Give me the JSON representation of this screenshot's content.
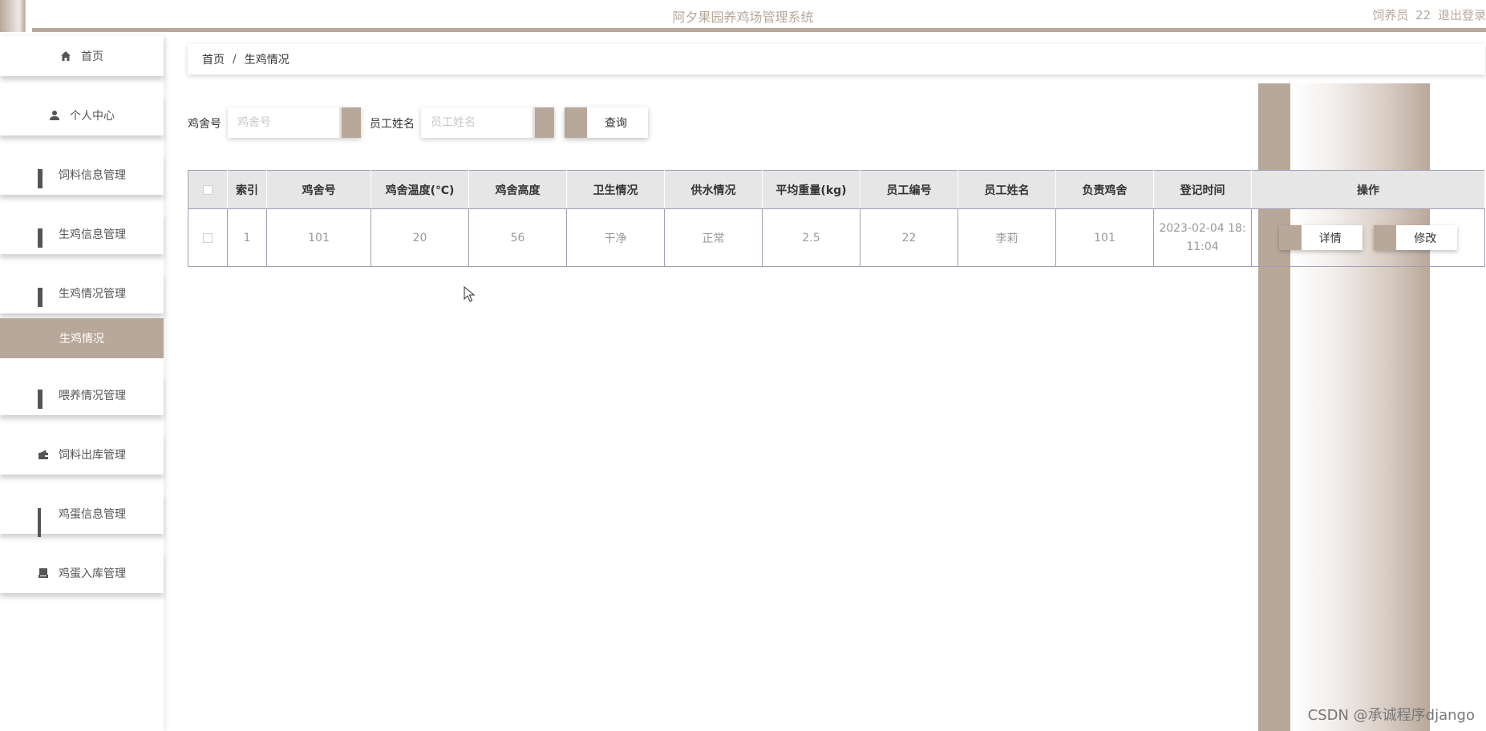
{
  "header": {
    "title": "阿夕果园养鸡场管理系统",
    "user_role": "饲养员",
    "user_id": "22",
    "logout_label": "退出登录"
  },
  "sidebar": {
    "items": [
      {
        "label": "首页",
        "icon": "home-icon"
      },
      {
        "label": "个人中心",
        "icon": "user-icon"
      },
      {
        "label": "饲料信息管理",
        "icon": "grid-icon"
      },
      {
        "label": "生鸡信息管理",
        "icon": "grid-icon"
      },
      {
        "label": "生鸡情况管理",
        "icon": "grid-icon"
      },
      {
        "label": "生鸡情况",
        "icon": ""
      },
      {
        "label": "喂养情况管理",
        "icon": "grid-icon"
      },
      {
        "label": "饲料出库管理",
        "icon": "wallet-icon"
      },
      {
        "label": "鸡蛋信息管理",
        "icon": "grid9-icon"
      },
      {
        "label": "鸡蛋入库管理",
        "icon": "printer-icon"
      }
    ]
  },
  "breadcrumb": {
    "home": "首页",
    "separator": "/",
    "current": "生鸡情况"
  },
  "search": {
    "coop_label": "鸡舍号",
    "coop_placeholder": "鸡舍号",
    "coop_value": "",
    "staff_label": "员工姓名",
    "staff_placeholder": "员工姓名",
    "staff_value": "",
    "query_label": "查询"
  },
  "table": {
    "columns": [
      "索引",
      "鸡舍号",
      "鸡舍温度(℃)",
      "鸡舍高度",
      "卫生情况",
      "供水情况",
      "平均重量(kg)",
      "员工编号",
      "员工姓名",
      "负责鸡舍",
      "登记时间",
      "操作"
    ],
    "rows": [
      {
        "index": "1",
        "coop": "101",
        "temp": "20",
        "height": "56",
        "hygiene": "干净",
        "water": "正常",
        "weight": "2.5",
        "staff_no": "22",
        "staff_name": "李莉",
        "responsible": "101",
        "time": "2023-02-04 18:11:04",
        "detail_label": "详情",
        "edit_label": "修改"
      }
    ]
  },
  "watermark": "CSDN @承诚程序django",
  "colors": {
    "accent": "#b8a89a",
    "header_bg": "#e6e6e6",
    "border": "#9f9fb5"
  }
}
